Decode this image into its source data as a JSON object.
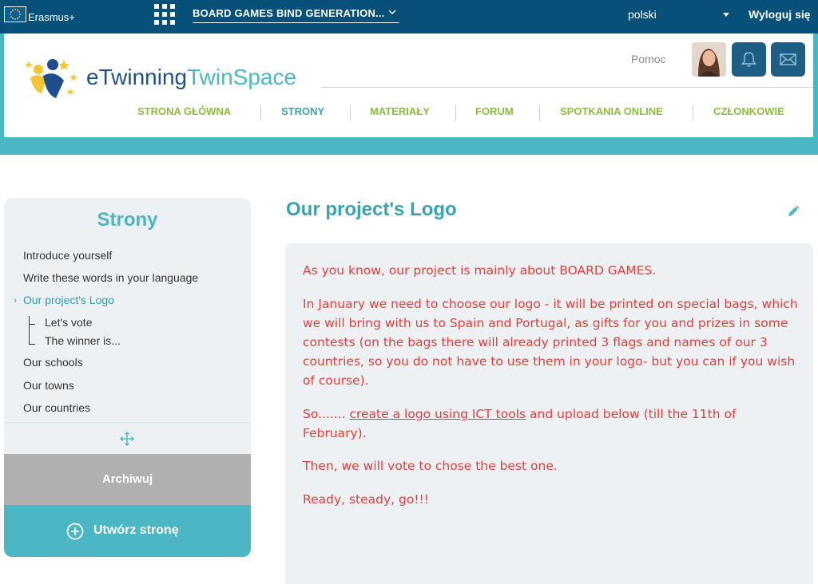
{
  "topbar": {
    "program": "Erasmus+",
    "project_title": "BOARD GAMES BIND GENERATION...",
    "language": "polski",
    "logout": "Wyloguj się"
  },
  "header": {
    "brand_etwinning": "eTwinning",
    "brand_twinspace": "TwinSpace",
    "help": "Pomoc",
    "nav": [
      {
        "label": "STRONA GŁÓWNA"
      },
      {
        "label": "STRONY"
      },
      {
        "label": "MATERIAŁY"
      },
      {
        "label": "FORUM"
      },
      {
        "label": "SPOTKANIA ONLINE"
      },
      {
        "label": "CZŁONKOWIE"
      }
    ]
  },
  "colors": {
    "topbar": "#06507a",
    "accent": "#4bb6c4",
    "nav_green": "#8bbf3a",
    "title_teal": "#3aa3b2",
    "content_red": "#e0403a",
    "panel_bg": "#eef1f4"
  },
  "sidebar": {
    "title": "Strony",
    "pages": [
      {
        "label": "Introduce yourself"
      },
      {
        "label": "Write these words in your language"
      },
      {
        "label": "Our project's Logo"
      },
      {
        "label": "Let's vote"
      },
      {
        "label": "The winner is..."
      },
      {
        "label": "Our schools"
      },
      {
        "label": "Our towns"
      },
      {
        "label": "Our countries"
      }
    ],
    "archive_label": "Archiwuj",
    "create_label": "Utwórz stronę"
  },
  "main": {
    "title": "Our project's Logo",
    "paragraphs": {
      "p1": "As you know, our project is mainly about BOARD GAMES.",
      "p2": "In January we need to choose our logo - it will be printed on special bags, which we will bring with us to Spain and Portugal,  as gifts for you and prizes in some contests (on the bags there will already printed 3 flags and names of our 3 countries, so you do not have to use them in your logo- but you can if you wish of course).",
      "p3_before": "So....... ",
      "p3_link": "create a logo using ICT tools",
      "p3_after": " and upload below (till the 11th of February).",
      "p4": "Then, we will vote to chose the best one.",
      "p5": "Ready, steady, go!!!"
    }
  }
}
